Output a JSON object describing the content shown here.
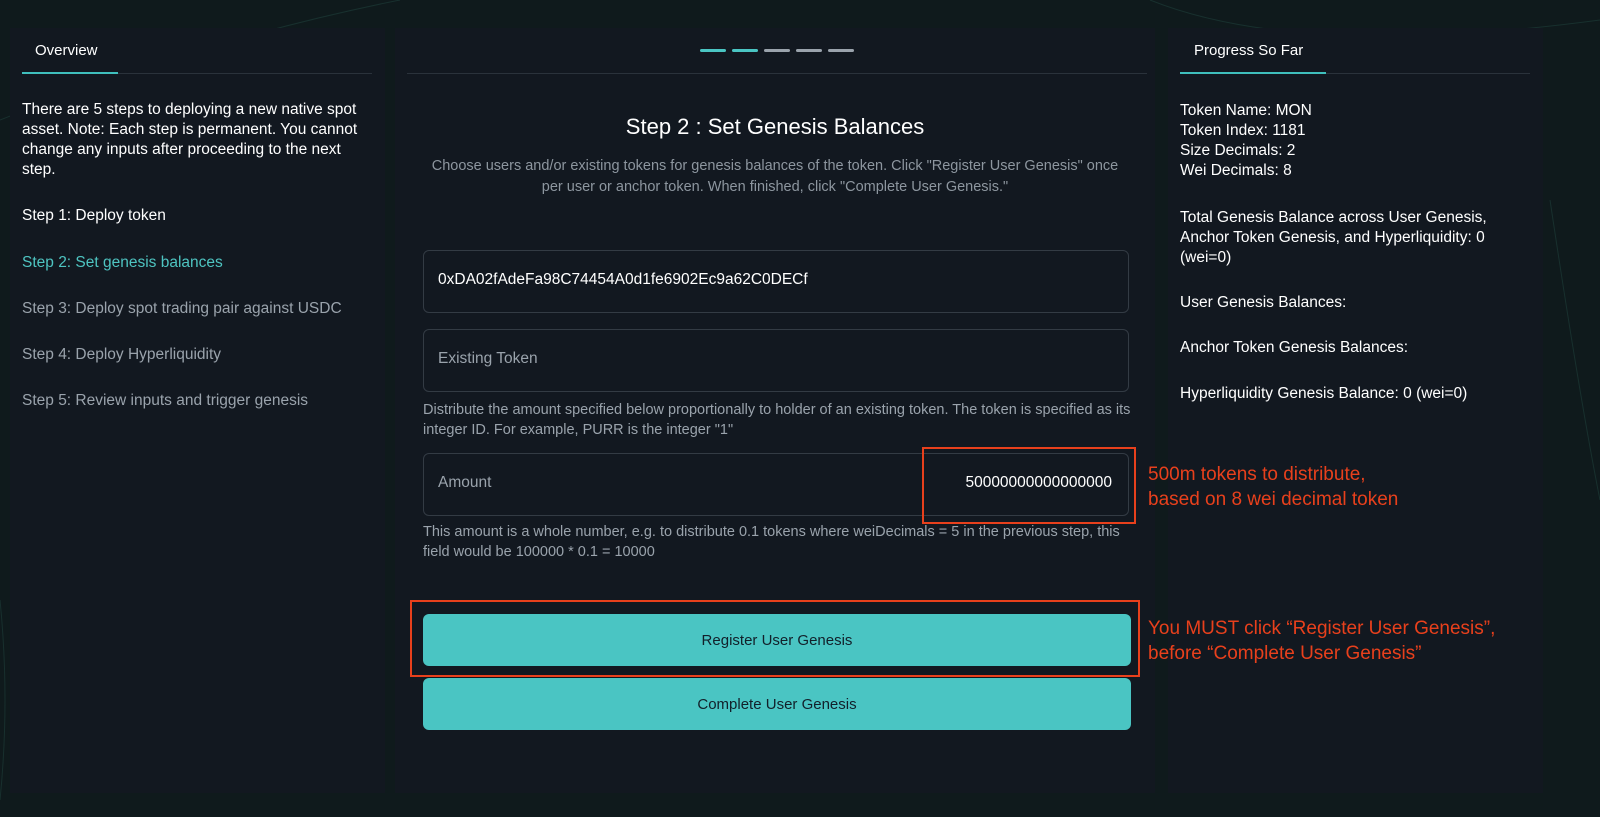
{
  "overview": {
    "tab_label": "Overview",
    "intro": "There are 5 steps to deploying a new native spot asset. Note: Each step is permanent. You cannot change any inputs after proceeding to the next step.",
    "steps": [
      "Step 1: Deploy token",
      "Step 2: Set genesis balances",
      "Step 3: Deploy spot trading pair against USDC",
      "Step 4: Deploy Hyperliquidity",
      "Step 5: Review inputs and trigger genesis"
    ]
  },
  "main": {
    "progress_steps": 5,
    "progress_completed": 2,
    "title": "Step 2 : Set Genesis Balances",
    "subtitle": "Choose users and/or existing tokens for genesis balances of the token. Click \"Register User Genesis\" once per user or anchor token. When finished, click \"Complete User Genesis.\"",
    "address_value": "0xDA02fAdeFa98C74454A0d1fe6902Ec9a62C0DECf",
    "existing_token_placeholder": "Existing Token",
    "existing_token_help": "Distribute the amount specified below proportionally to holder of an existing token. The token is specified as its integer ID. For example, PURR is the integer \"1\"",
    "amount_label": "Amount",
    "amount_value": "50000000000000000",
    "amount_help": "This amount is a whole number, e.g. to distribute 0.1 tokens where weiDecimals = 5 in the previous step, this field would be 100000 * 0.1 = 10000",
    "register_button": "Register User Genesis",
    "complete_button": "Complete User Genesis"
  },
  "progress": {
    "tab_label": "Progress So Far",
    "token_name": "Token Name: MON",
    "token_index": "Token Index: 1181",
    "size_decimals": "Size Decimals: 2",
    "wei_decimals": "Wei Decimals: 8",
    "total_genesis": "Total Genesis Balance across User Genesis, Anchor Token Genesis, and Hyperliquidity: 0 (wei=0)",
    "user_genesis": "User Genesis Balances:",
    "anchor_genesis": "Anchor Token Genesis Balances:",
    "hyper_genesis": "Hyperliquidity Genesis Balance: 0 (wei=0)"
  },
  "annotations": {
    "amount_note_1": "500m tokens to distribute,",
    "amount_note_2": "based on 8 wei decimal token",
    "register_note_1": "You MUST click “Register User Genesis”,",
    "register_note_2": "before “Complete User Genesis”"
  },
  "colors": {
    "accent": "#4ac5c3",
    "annotation_red": "#e8401c",
    "panel_bg": "#121820",
    "page_bg": "#0f1a1c"
  }
}
